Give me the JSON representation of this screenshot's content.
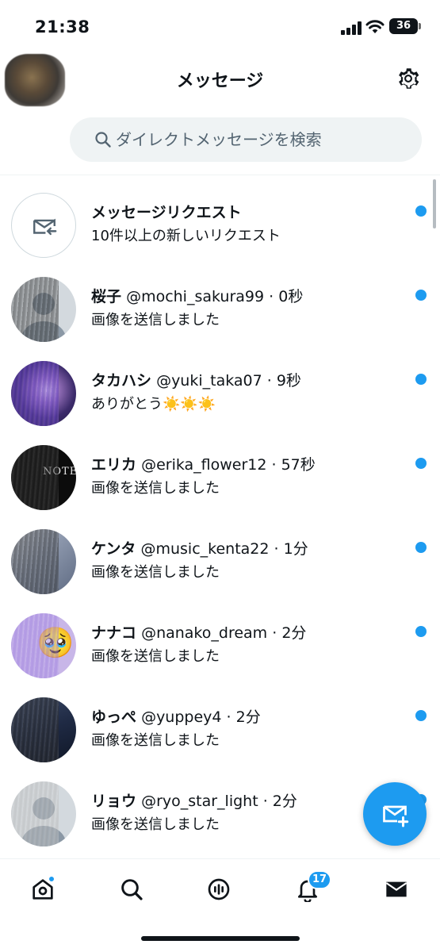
{
  "status_bar": {
    "time": "21:38",
    "battery": "36"
  },
  "header": {
    "title": "メッセージ",
    "settings_icon": "gear-icon"
  },
  "search": {
    "placeholder": "ダイレクトメッセージを検索"
  },
  "conversations": [
    {
      "kind": "request",
      "name": "メッセージリクエスト",
      "handle": "",
      "time": "",
      "preview": "10件以上の新しいリクエスト",
      "unread": true
    },
    {
      "name": "桜子",
      "handle": "@mochi_sakura99",
      "time": "0秒",
      "preview": "画像を送信しました",
      "unread": true
    },
    {
      "name": "タカハシ",
      "handle": "@yuki_taka07",
      "time": "9秒",
      "preview": "ありがとう",
      "preview_emoji": "☀️☀️☀️",
      "unread": true
    },
    {
      "name": "エリカ",
      "handle": "@erika_flower12",
      "time": "57秒",
      "preview": "画像を送信しました",
      "avatar_text": "NOTE",
      "unread": true
    },
    {
      "name": "ケンタ",
      "handle": "@music_kenta22",
      "time": "1分",
      "preview": "画像を送信しました",
      "unread": true
    },
    {
      "name": "ナナコ",
      "handle": "@nanako_dream",
      "time": "2分",
      "preview": "画像を送信しました",
      "avatar_emoji": "🥹",
      "unread": true
    },
    {
      "name": "ゆっぺ",
      "handle": "@yuppey4",
      "time": "2分",
      "preview": "画像を送信しました",
      "unread": true
    },
    {
      "name": "リョウ",
      "handle": "@ryo_star_light",
      "time": "2分",
      "preview": "画像を送信しました",
      "unread": true
    }
  ],
  "separator": " · ",
  "bottom_nav": {
    "items": [
      "home-icon",
      "search-icon",
      "spaces-icon",
      "bell-icon",
      "mail-icon"
    ],
    "notification_count": "17"
  },
  "colors": {
    "accent": "#1d9bf0",
    "text": "#0f1419",
    "muted": "#536471",
    "search_bg": "#eff3f4"
  }
}
